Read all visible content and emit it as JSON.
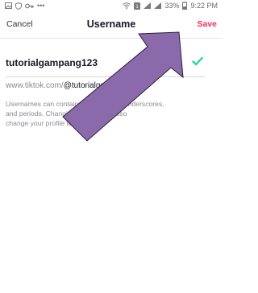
{
  "status_bar": {
    "battery": "33%",
    "time": "9:22 PM"
  },
  "header": {
    "cancel_label": "Cancel",
    "title": "Username",
    "save_label": "Save"
  },
  "username_field": {
    "value": "tutorialgampang123"
  },
  "profile_url": {
    "prefix": "www.tiktok.com/",
    "handle": "@tutorialgam"
  },
  "help": {
    "line1": "Usernames can contain o",
    "line1_tail": "bers, underscores,",
    "line2": "and periods. Changing",
    "line2_tail": "will also",
    "line3": "change your profile link."
  },
  "colors": {
    "accent": "#fe2c55",
    "check": "#20d5a0",
    "arrow_fill": "#8b6aac",
    "arrow_stroke": "#2a1c3a"
  }
}
